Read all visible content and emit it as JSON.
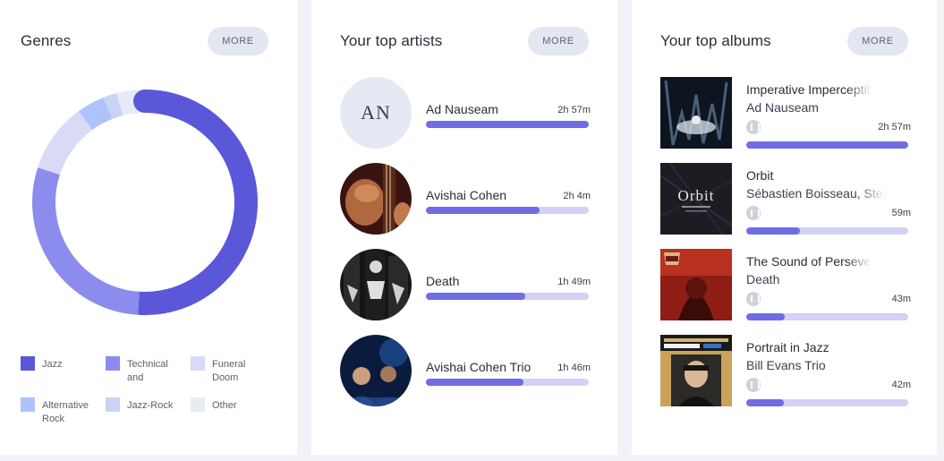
{
  "genres": {
    "title": "Genres",
    "more_label": "MORE",
    "chart_data": {
      "type": "pie",
      "categories": [
        "Jazz",
        "Technical and",
        "Funeral Doom",
        "Alternative Rock",
        "Jazz-Rock",
        "Other"
      ],
      "values": [
        51,
        29,
        10,
        4,
        2,
        4
      ],
      "colors": [
        "#5b57d9",
        "#8c8cef",
        "#d9daf6",
        "#aec3fb",
        "#c9d3f5",
        "#e7ebf4"
      ]
    },
    "legend": [
      {
        "label": "Jazz",
        "color": "#5b57d9"
      },
      {
        "label": "Technical and",
        "color": "#8c8cef"
      },
      {
        "label": "Funeral Doom",
        "color": "#d9daf6"
      },
      {
        "label": "Alternative Rock",
        "color": "#aec3fb"
      },
      {
        "label": "Jazz-Rock",
        "color": "#c9d3f5"
      },
      {
        "label": "Other",
        "color": "#e7ebf4"
      }
    ]
  },
  "artists": {
    "title": "Your top artists",
    "more_label": "MORE",
    "items": [
      {
        "name": "Ad Nauseam",
        "time": "2h 57m",
        "progress": 1.0,
        "initials": "AN"
      },
      {
        "name": "Avishai Cohen",
        "time": "2h 4m",
        "progress": 0.7
      },
      {
        "name": "Death",
        "time": "1h 49m",
        "progress": 0.61
      },
      {
        "name": "Avishai Cohen Trio",
        "time": "1h 46m",
        "progress": 0.6
      }
    ]
  },
  "albums": {
    "title": "Your top albums",
    "more_label": "MORE",
    "items": [
      {
        "title": "Imperative Imperceptible Impulse",
        "artist": "Ad Nauseam",
        "time": "2h 57m",
        "progress": 1.0
      },
      {
        "title": "Orbit",
        "artist": "Sébastien Boisseau, Stephan Oliva",
        "time": "59m",
        "progress": 0.33,
        "cover_text": "Orbit"
      },
      {
        "title": "The Sound of Perseverance",
        "artist": "Death",
        "time": "43m",
        "progress": 0.24
      },
      {
        "title": "Portrait in Jazz",
        "artist": "Bill Evans Trio",
        "time": "42m",
        "progress": 0.23
      }
    ]
  },
  "icons": {
    "source": "music-service-icon"
  }
}
